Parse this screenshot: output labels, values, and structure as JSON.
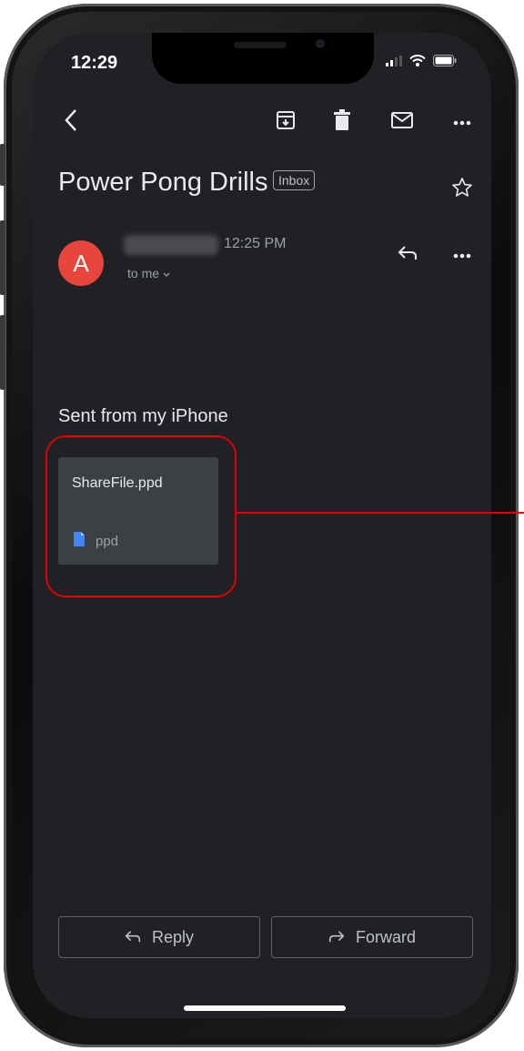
{
  "status_bar": {
    "time": "12:29"
  },
  "toolbar": {
    "icons": [
      "back-icon",
      "archive-icon",
      "trash-icon",
      "mail-icon",
      "more-icon"
    ]
  },
  "email": {
    "subject": "Power Pong Drills",
    "label": "Inbox",
    "sender_initial": "A",
    "time": "12:25 PM",
    "recipient": "to me",
    "body": "Sent from my iPhone",
    "attachment": {
      "filename": "ShareFile.ppd",
      "type": "ppd"
    }
  },
  "actions": {
    "reply": "Reply",
    "forward": "Forward"
  },
  "colors": {
    "screen_bg": "#202124",
    "avatar": "#e8453c",
    "highlight": "#e00000",
    "file_icon": "#4285f4"
  }
}
